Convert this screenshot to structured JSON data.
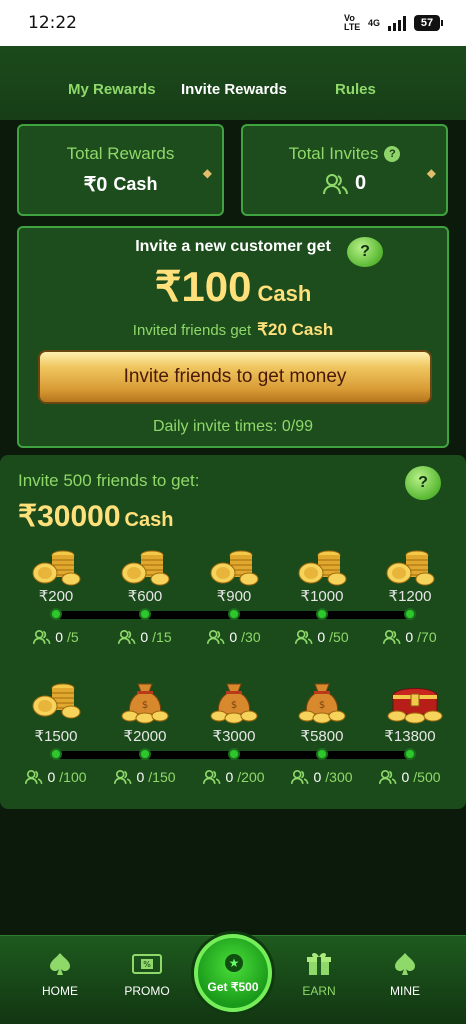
{
  "status_bar": {
    "time": "12:22",
    "network": "4G",
    "volte": "Vo LTE",
    "battery": "57"
  },
  "tabs": {
    "my_rewards": "My Rewards",
    "invite_rewards": "Invite Rewards",
    "rules": "Rules"
  },
  "stats": {
    "total_rewards_label": "Total Rewards",
    "total_rewards_value": "₹0",
    "total_rewards_unit": "Cash",
    "total_invites_label": "Total Invites",
    "total_invites_value": "0"
  },
  "invite_card": {
    "title": "Invite a new customer get",
    "amount": "₹100",
    "amount_unit": "Cash",
    "friends_label": "Invited friends get",
    "friends_amount": "₹20 Cash",
    "button_label": "Invite friends to get money",
    "daily_label": "Daily invite times: 0/99"
  },
  "milestones": {
    "title": "Invite 500 friends to get:",
    "amount": "₹30000",
    "amount_unit": "Cash",
    "items": [
      {
        "reward": "₹200",
        "current": "0",
        "target": "/5",
        "icon": "coins-icon"
      },
      {
        "reward": "₹600",
        "current": "0",
        "target": "/15",
        "icon": "coins-icon"
      },
      {
        "reward": "₹900",
        "current": "0",
        "target": "/30",
        "icon": "coins-icon"
      },
      {
        "reward": "₹1000",
        "current": "0",
        "target": "/50",
        "icon": "coins-icon"
      },
      {
        "reward": "₹1200",
        "current": "0",
        "target": "/70",
        "icon": "coins-icon"
      },
      {
        "reward": "₹1500",
        "current": "0",
        "target": "/100",
        "icon": "coins-icon"
      },
      {
        "reward": "₹2000",
        "current": "0",
        "target": "/150",
        "icon": "money-bag-icon"
      },
      {
        "reward": "₹3000",
        "current": "0",
        "target": "/200",
        "icon": "money-bag-icon"
      },
      {
        "reward": "₹5800",
        "current": "0",
        "target": "/300",
        "icon": "money-bag-icon"
      },
      {
        "reward": "₹13800",
        "current": "0",
        "target": "/500",
        "icon": "treasure-chest-icon"
      }
    ]
  },
  "nav": {
    "home": "HOME",
    "promo": "PROMO",
    "center": "Get ₹500",
    "earn": "EARN",
    "mine": "MINE"
  },
  "colors": {
    "accent_green": "#8fd86a",
    "gold": "#ffe07a",
    "card_border": "#3fa33f"
  }
}
